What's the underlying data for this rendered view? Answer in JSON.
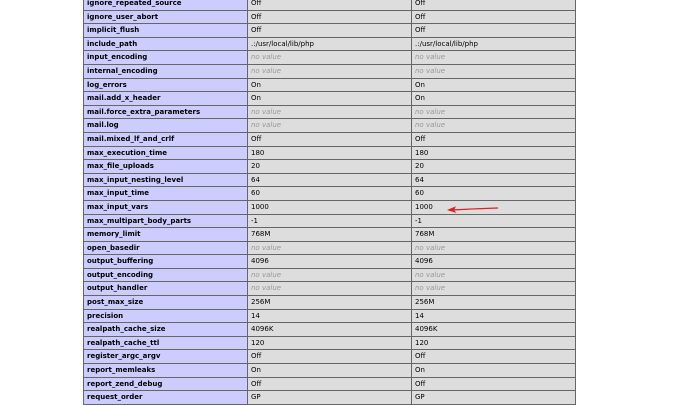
{
  "rows": [
    {
      "name": "ignore_repeated_source",
      "local": "Off",
      "master": "Off"
    },
    {
      "name": "ignore_user_abort",
      "local": "Off",
      "master": "Off"
    },
    {
      "name": "implicit_flush",
      "local": "Off",
      "master": "Off"
    },
    {
      "name": "include_path",
      "local": ".:/usr/local/lib/php",
      "master": ".:/usr/local/lib/php"
    },
    {
      "name": "input_encoding",
      "local": "no value",
      "master": "no value"
    },
    {
      "name": "internal_encoding",
      "local": "no value",
      "master": "no value"
    },
    {
      "name": "log_errors",
      "local": "On",
      "master": "On"
    },
    {
      "name": "mail.add_x_header",
      "local": "On",
      "master": "On"
    },
    {
      "name": "mail.force_extra_parameters",
      "local": "no value",
      "master": "no value"
    },
    {
      "name": "mail.log",
      "local": "no value",
      "master": "no value"
    },
    {
      "name": "mail.mixed_lf_and_crlf",
      "local": "Off",
      "master": "Off"
    },
    {
      "name": "max_execution_time",
      "local": "180",
      "master": "180"
    },
    {
      "name": "max_file_uploads",
      "local": "20",
      "master": "20"
    },
    {
      "name": "max_input_nesting_level",
      "local": "64",
      "master": "64"
    },
    {
      "name": "max_input_time",
      "local": "60",
      "master": "60"
    },
    {
      "name": "max_input_vars",
      "local": "1000",
      "master": "1000"
    },
    {
      "name": "max_multipart_body_parts",
      "local": "-1",
      "master": "-1"
    },
    {
      "name": "memory_limit",
      "local": "768M",
      "master": "768M"
    },
    {
      "name": "open_basedir",
      "local": "no value",
      "master": "no value"
    },
    {
      "name": "output_buffering",
      "local": "4096",
      "master": "4096"
    },
    {
      "name": "output_encoding",
      "local": "no value",
      "master": "no value"
    },
    {
      "name": "output_handler",
      "local": "no value",
      "master": "no value"
    },
    {
      "name": "post_max_size",
      "local": "256M",
      "master": "256M"
    },
    {
      "name": "precision",
      "local": "14",
      "master": "14"
    },
    {
      "name": "realpath_cache_size",
      "local": "4096K",
      "master": "4096K"
    },
    {
      "name": "realpath_cache_ttl",
      "local": "120",
      "master": "120"
    },
    {
      "name": "register_argc_argv",
      "local": "Off",
      "master": "Off"
    },
    {
      "name": "report_memleaks",
      "local": "On",
      "master": "On"
    },
    {
      "name": "report_zend_debug",
      "local": "Off",
      "master": "Off"
    },
    {
      "name": "request_order",
      "local": "GP",
      "master": "GP"
    }
  ],
  "colors": {
    "key_bg": "#ccccff",
    "value_bg": "#dddddd",
    "no_value": "#999999",
    "arrow": "#e02020"
  },
  "annotation": {
    "target_row": "max_input_vars",
    "icon": "red-arrow-icon"
  }
}
